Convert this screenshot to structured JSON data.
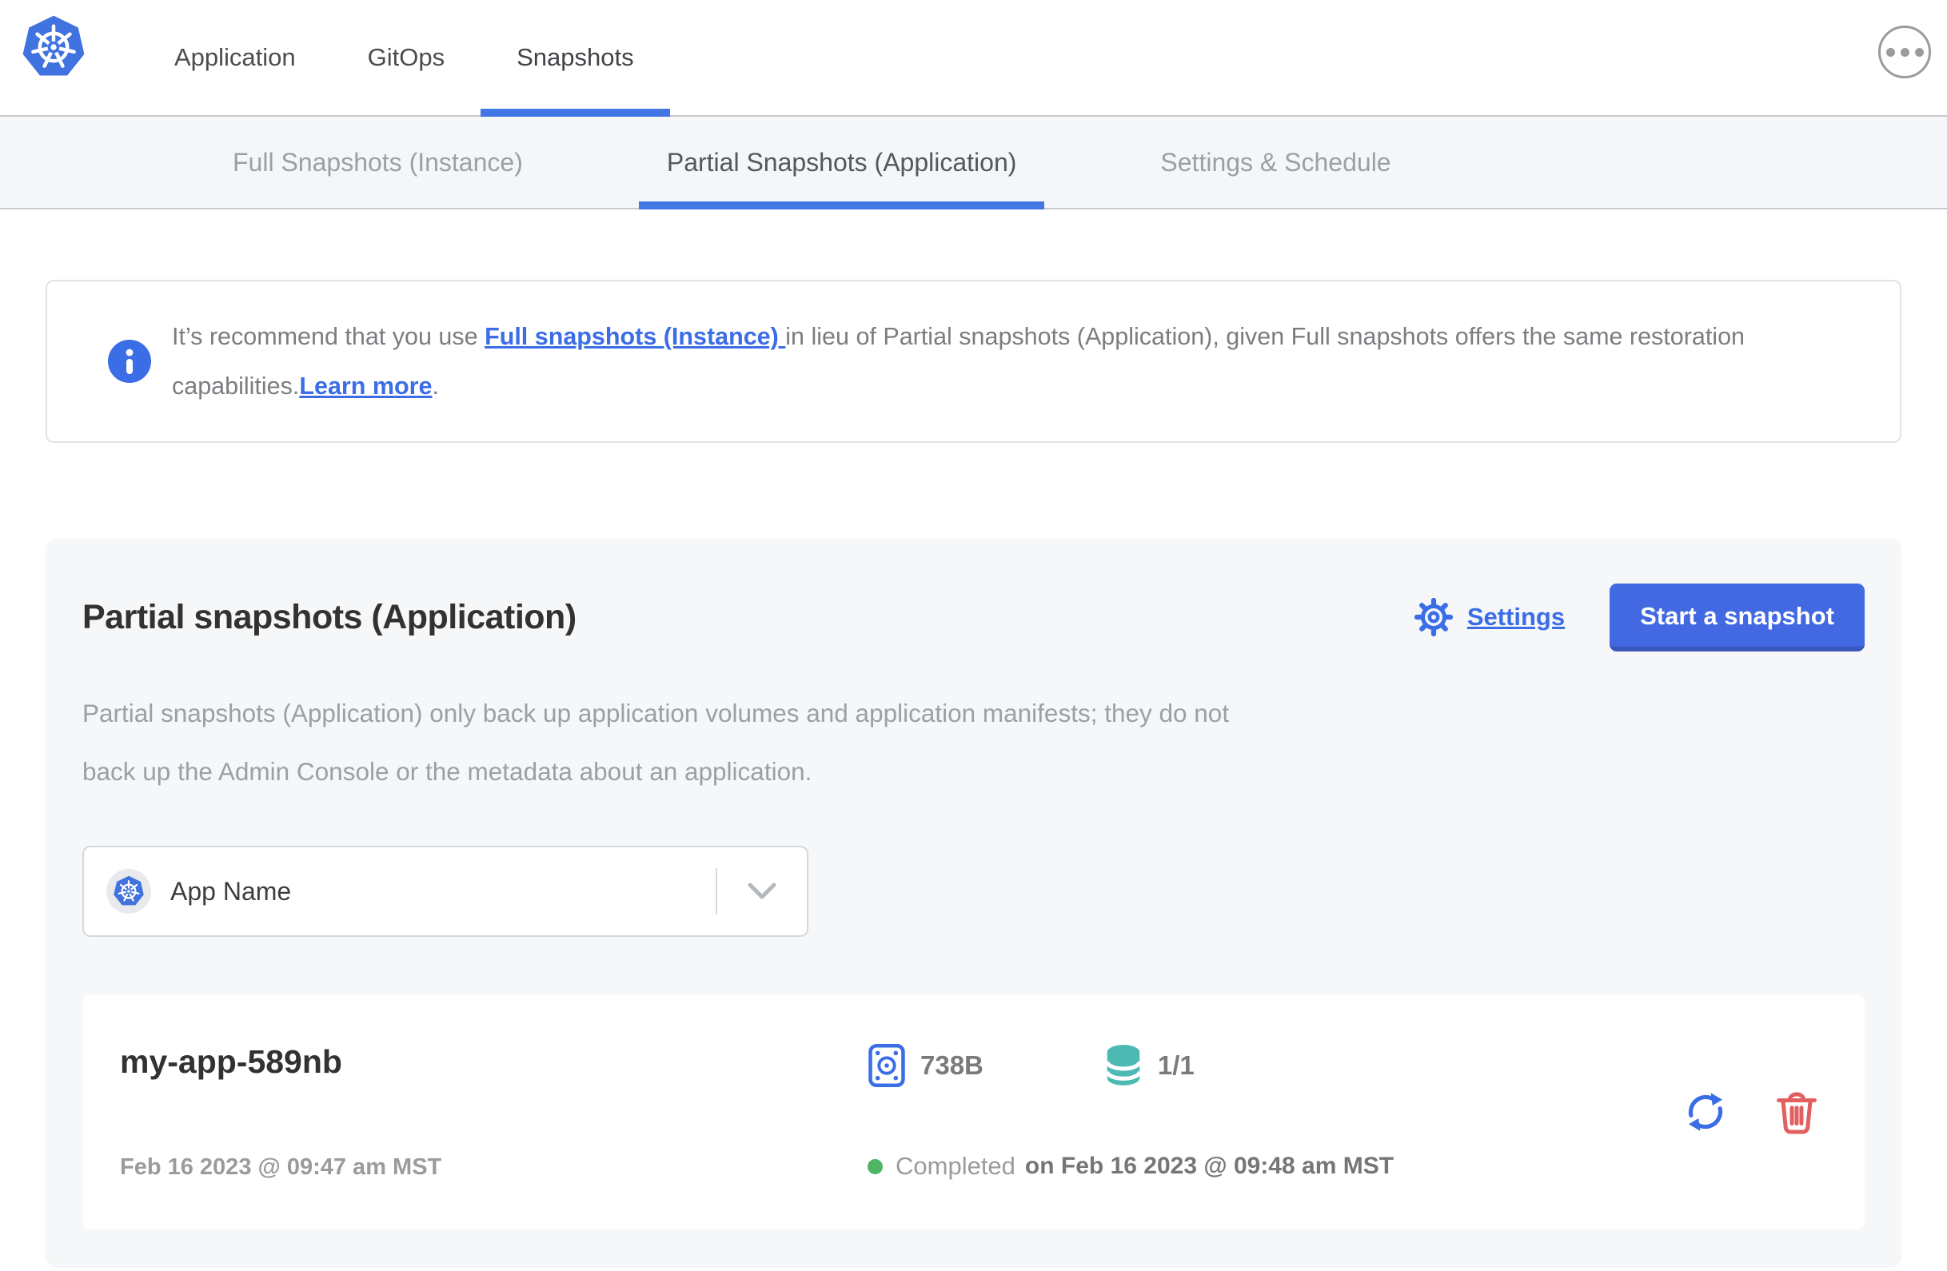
{
  "colors": {
    "accent_blue": "#3b6de6",
    "button_blue": "#4269e2",
    "active_underline_blue": "#4176e4",
    "teal": "#4db9b3",
    "success_green": "#4db564",
    "danger_red": "#e25f5f"
  },
  "icons": {
    "logo": "kubernetes-logo",
    "more": "ellipsis-menu-icon",
    "info": "info-icon",
    "settings": "gear-icon",
    "app_selector": "kubernetes-app-icon",
    "dropdown": "chevron-down-icon",
    "size": "disk-icon",
    "volumes": "database-icon",
    "status": "status-dot",
    "restore": "restore-icon",
    "delete": "trash-icon"
  },
  "header": {
    "nav": [
      {
        "label": "Application",
        "active": false
      },
      {
        "label": "GitOps",
        "active": false
      },
      {
        "label": "Snapshots",
        "active": true
      }
    ]
  },
  "subtabs": [
    {
      "label": "Full Snapshots (Instance)",
      "active": false
    },
    {
      "label": "Partial Snapshots (Application)",
      "active": true
    },
    {
      "label": "Settings & Schedule",
      "active": false
    }
  ],
  "banner": {
    "text_start": "It’s recommend that you use ",
    "link_full_snapshots": "Full snapshots (Instance) ",
    "text_middle": "in lieu of Partial snapshots (Application), given Full snapshots offers the same restoration capabilities.",
    "link_learn_more": "Learn more",
    "text_end": "."
  },
  "section": {
    "title": "Partial snapshots (Application)",
    "settings_label": "Settings",
    "start_snapshot_label": "Start a snapshot",
    "description": "Partial snapshots (Application) only back up application volumes and application manifests; they do not back up the Admin Console or the metadata about an application.",
    "app_selector": {
      "value": "App Name"
    },
    "snapshots": [
      {
        "name": "my-app-589nb",
        "started": "Feb 16 2023 @ 09:47 am MST",
        "size": "738B",
        "volumes": "1/1",
        "status": "Completed",
        "status_detail": "on Feb 16 2023 @ 09:48 am MST"
      }
    ]
  }
}
